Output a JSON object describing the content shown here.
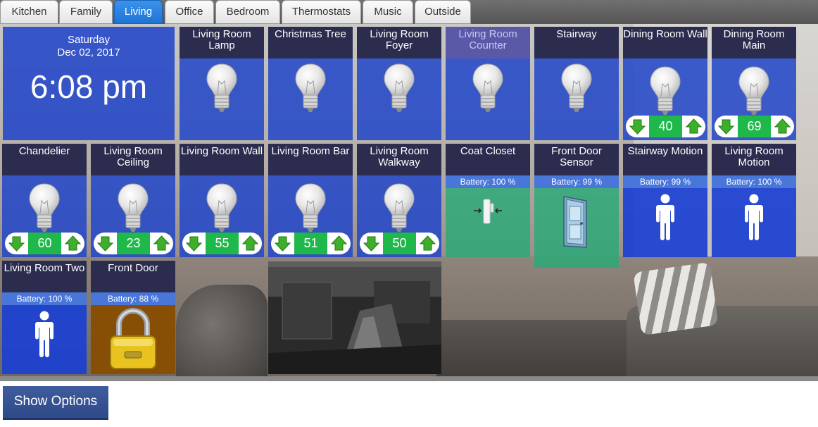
{
  "tabs": [
    {
      "label": "Kitchen",
      "active": false
    },
    {
      "label": "Family",
      "active": false
    },
    {
      "label": "Living",
      "active": true
    },
    {
      "label": "Office",
      "active": false
    },
    {
      "label": "Bedroom",
      "active": false
    },
    {
      "label": "Thermostats",
      "active": false
    },
    {
      "label": "Music",
      "active": false
    },
    {
      "label": "Outside",
      "active": false
    }
  ],
  "clock": {
    "day": "Saturday",
    "date": "Dec 02, 2017",
    "time": "6:08 pm"
  },
  "lights": {
    "lamp": {
      "title": "Living Room\nLamp"
    },
    "tree": {
      "title": "Christmas Tree"
    },
    "foyer": {
      "title": "Living Room\nFoyer"
    },
    "counter": {
      "title": "Living Room\nCounter"
    },
    "stairway": {
      "title": "Stairway"
    },
    "diningwall": {
      "title": "Dining Room Wall",
      "level": "40"
    },
    "diningmain": {
      "title": "Dining Room\nMain",
      "level": "69"
    },
    "chandelier": {
      "title": "Chandelier",
      "level": "60"
    },
    "ceiling": {
      "title": "Living Room\nCeiling",
      "level": "23"
    },
    "wall": {
      "title": "Living Room Wall",
      "level": "55"
    },
    "bar": {
      "title": "Living Room Bar",
      "level": "51"
    },
    "walkway": {
      "title": "Living Room\nWalkway",
      "level": "50"
    }
  },
  "sensors": {
    "coatcloset": {
      "title": "Coat Closet",
      "battery": "Battery: 100 %"
    },
    "frontdoorsensor": {
      "title": "Front Door\nSensor",
      "battery": "Battery: 99 %"
    },
    "stairwaymotion": {
      "title": "Stairway Motion",
      "battery": "Battery: 99 %"
    },
    "lrmotion": {
      "title": "Living Room\nMotion",
      "battery": "Battery: 100 %"
    },
    "lrtwo": {
      "title": "Living Room Two",
      "battery": "Battery: 100 %"
    },
    "frontdoor": {
      "title": "Front Door",
      "battery": "Battery: 88 %"
    }
  },
  "footer": {
    "show_options": "Show Options"
  },
  "icons": {
    "light": "lightbulb-icon",
    "down": "arrow-down-icon",
    "up": "arrow-up-icon",
    "contact": "contact-sensor-icon",
    "door": "door-icon",
    "motion": "person-icon",
    "lock": "padlock-icon"
  },
  "colors": {
    "tile_title_bg": "#2c2c4f",
    "tile_title_highlight": "#5a59a8",
    "tile_body_blue": "#2246c8",
    "level_green": "#1fb84a",
    "battery_bar": "#4876d9",
    "sensor_green": "#28aa78",
    "lock_brown": "#874e06",
    "tab_active": "#1e74d6",
    "show_options_bg": "#3f5c9e"
  }
}
